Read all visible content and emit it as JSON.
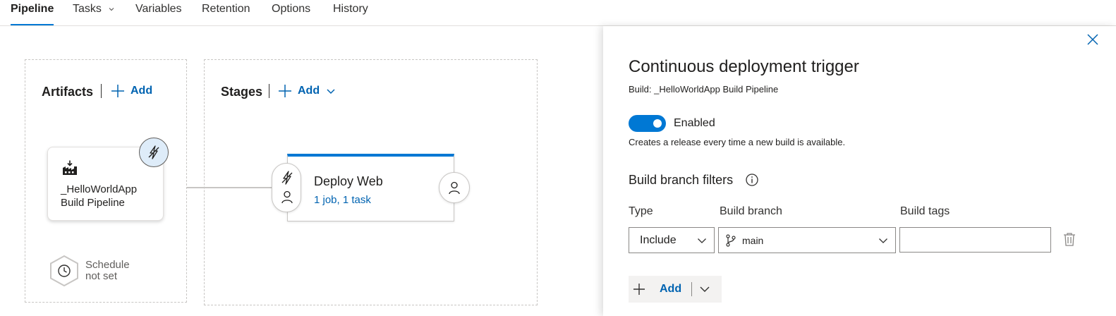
{
  "tabs": [
    {
      "label": "Pipeline",
      "active": true
    },
    {
      "label": "Tasks",
      "has_dropdown": true
    },
    {
      "label": "Variables"
    },
    {
      "label": "Retention"
    },
    {
      "label": "Options"
    },
    {
      "label": "History"
    }
  ],
  "artifacts": {
    "title": "Artifacts",
    "add_label": "Add",
    "artifact": {
      "name_line1": "_HelloWorldApp",
      "name_line2": "Build Pipeline",
      "icon": "build-pipeline-icon"
    },
    "trigger_icon": "lightning-icon",
    "schedule": {
      "line1": "Schedule",
      "line2": "not set",
      "icon": "clock-icon"
    }
  },
  "stages": {
    "title": "Stages",
    "add_label": "Add",
    "stage": {
      "name": "Deploy Web",
      "summary": "1 job, 1 task"
    },
    "pre_conditions_icons": [
      "lightning-icon",
      "person-icon"
    ],
    "post_conditions_icon": "person-icon"
  },
  "trigger_panel": {
    "title": "Continuous deployment trigger",
    "subtitle": "Build: _HelloWorldApp Build Pipeline",
    "toggle_label": "Enabled",
    "toggle_on": true,
    "description": "Creates a release every time a new build is available.",
    "filters_title": "Build branch filters",
    "columns": {
      "type": "Type",
      "branch": "Build branch",
      "tags": "Build tags"
    },
    "filter_row": {
      "type": "Include",
      "branch": "main",
      "tags": ""
    },
    "add_label": "Add"
  },
  "colors": {
    "accent": "#0078d4",
    "link": "#0063b1",
    "trigger_bg": "#deecf9"
  }
}
